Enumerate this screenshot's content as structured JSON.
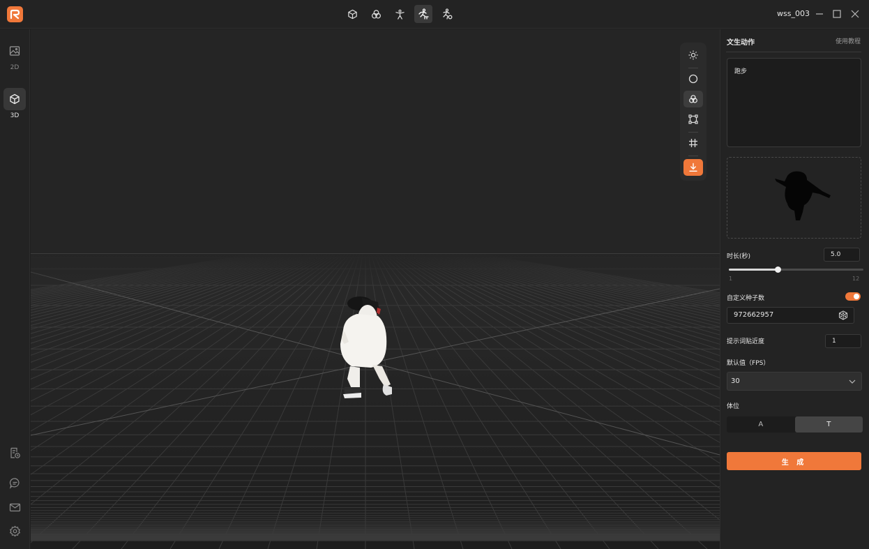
{
  "titlebar": {
    "project_name": "wss_003",
    "modes": [
      {
        "icon": "cube-icon",
        "active": false
      },
      {
        "icon": "three-circles-icon",
        "active": false
      },
      {
        "icon": "rig-skeleton-icon",
        "active": false
      },
      {
        "icon": "text-motion-icon",
        "active": true
      },
      {
        "icon": "video-motion-icon",
        "active": false
      }
    ]
  },
  "leftnav": {
    "items": [
      {
        "label": "2D",
        "icon": "image-icon",
        "active": false
      },
      {
        "label": "3D",
        "icon": "cube-icon",
        "active": true
      }
    ],
    "bottom_icons": [
      "task-list-icon",
      "chat-icon",
      "mail-icon",
      "settings-icon"
    ]
  },
  "viewport": {
    "toolbar": [
      "lighting-icon",
      "sphere-icon",
      "material-icon",
      "frame-icon",
      "grid-icon",
      "download-icon"
    ]
  },
  "panel": {
    "title": "文生动作",
    "tutorial": "使用教程",
    "prompt_text": "跑步",
    "duration": {
      "label": "时长(秒)",
      "value": "5.0",
      "min_label": "1",
      "max_label": "12",
      "min": 1,
      "max": 12,
      "current": 5.0
    },
    "custom_seed": {
      "label": "自定义种子数",
      "enabled": true,
      "value": "972662957"
    },
    "prompt_adherence": {
      "label": "提示词贴近度",
      "value": "1"
    },
    "fps": {
      "label": "默认值（FPS）",
      "value": "30"
    },
    "pose": {
      "label": "体位",
      "options": [
        "A",
        "T"
      ],
      "selected": "T"
    },
    "generate_label": "生 成"
  },
  "colors": {
    "accent": "#f0783a",
    "background": "#1f1f1f",
    "panel": "#232323"
  }
}
